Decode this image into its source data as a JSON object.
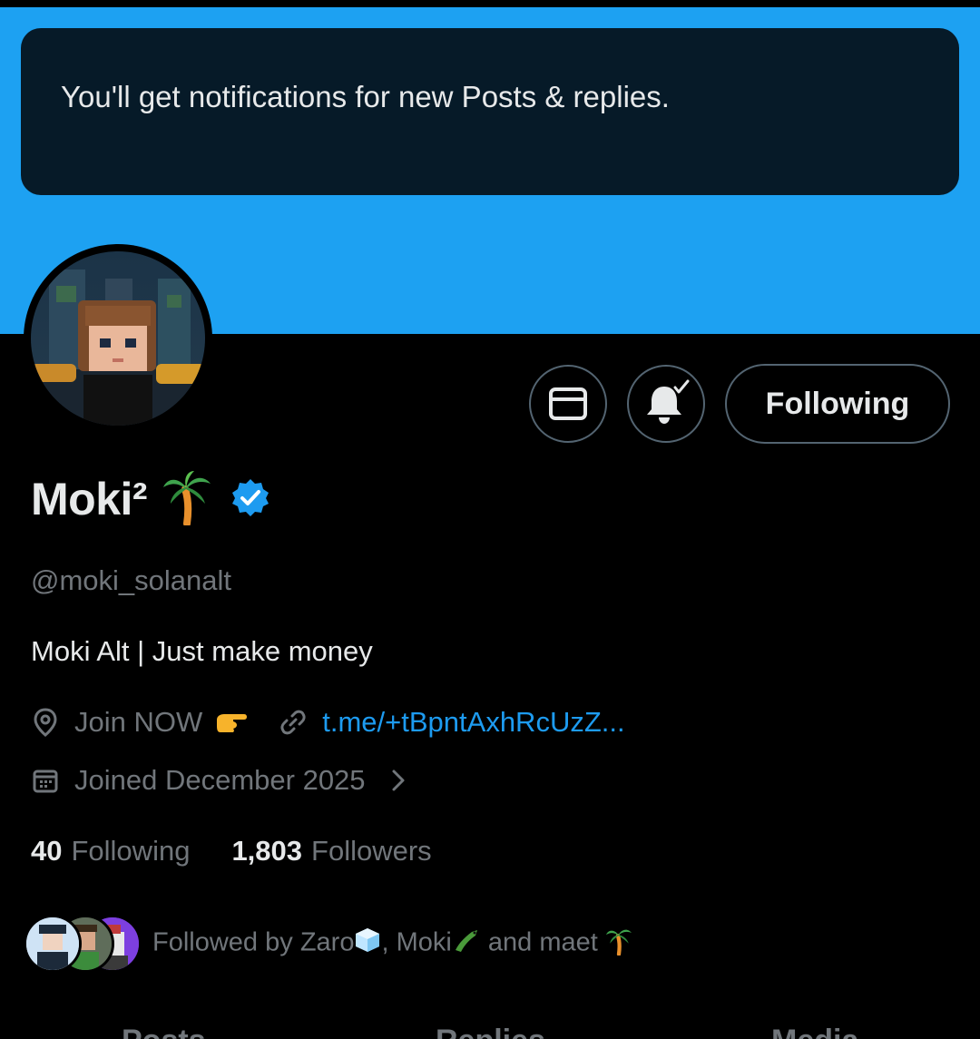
{
  "toast": {
    "message": "You'll get notifications for new Posts & replies."
  },
  "profile": {
    "display_name": "Moki²",
    "name_emoji": "palm-tree-emoji",
    "verified": true,
    "handle": "@moki_solanalt",
    "bio": "Moki Alt | Just make money",
    "location": "Join NOW",
    "location_emoji": "pointing-right-emoji",
    "website": "t.me/+tBpntAxhRcUzZ...",
    "joined": "Joined December 2025"
  },
  "actions": {
    "message_icon": "envelope-icon",
    "notify_icon": "bell-check-icon",
    "follow_label": "Following"
  },
  "stats": {
    "following_count": "40",
    "following_label": "Following",
    "followers_count": "1,803",
    "followers_label": "Followers"
  },
  "followed_by": {
    "prefix": "Followed by ",
    "user1": "Zaro",
    "user1_emoji": "ice-cube-emoji",
    "user2": "Moki",
    "user2_emoji": "crocodile-emoji",
    "joiner": "and",
    "user3": "maet",
    "user3_emoji": "palm-tree-emoji"
  },
  "tabs": [
    "Posts",
    "Replies",
    "Media"
  ],
  "colors": {
    "banner": "#1da1f2",
    "accent": "#1d9bf0",
    "muted": "#71767b",
    "text": "#e7e9ea"
  }
}
